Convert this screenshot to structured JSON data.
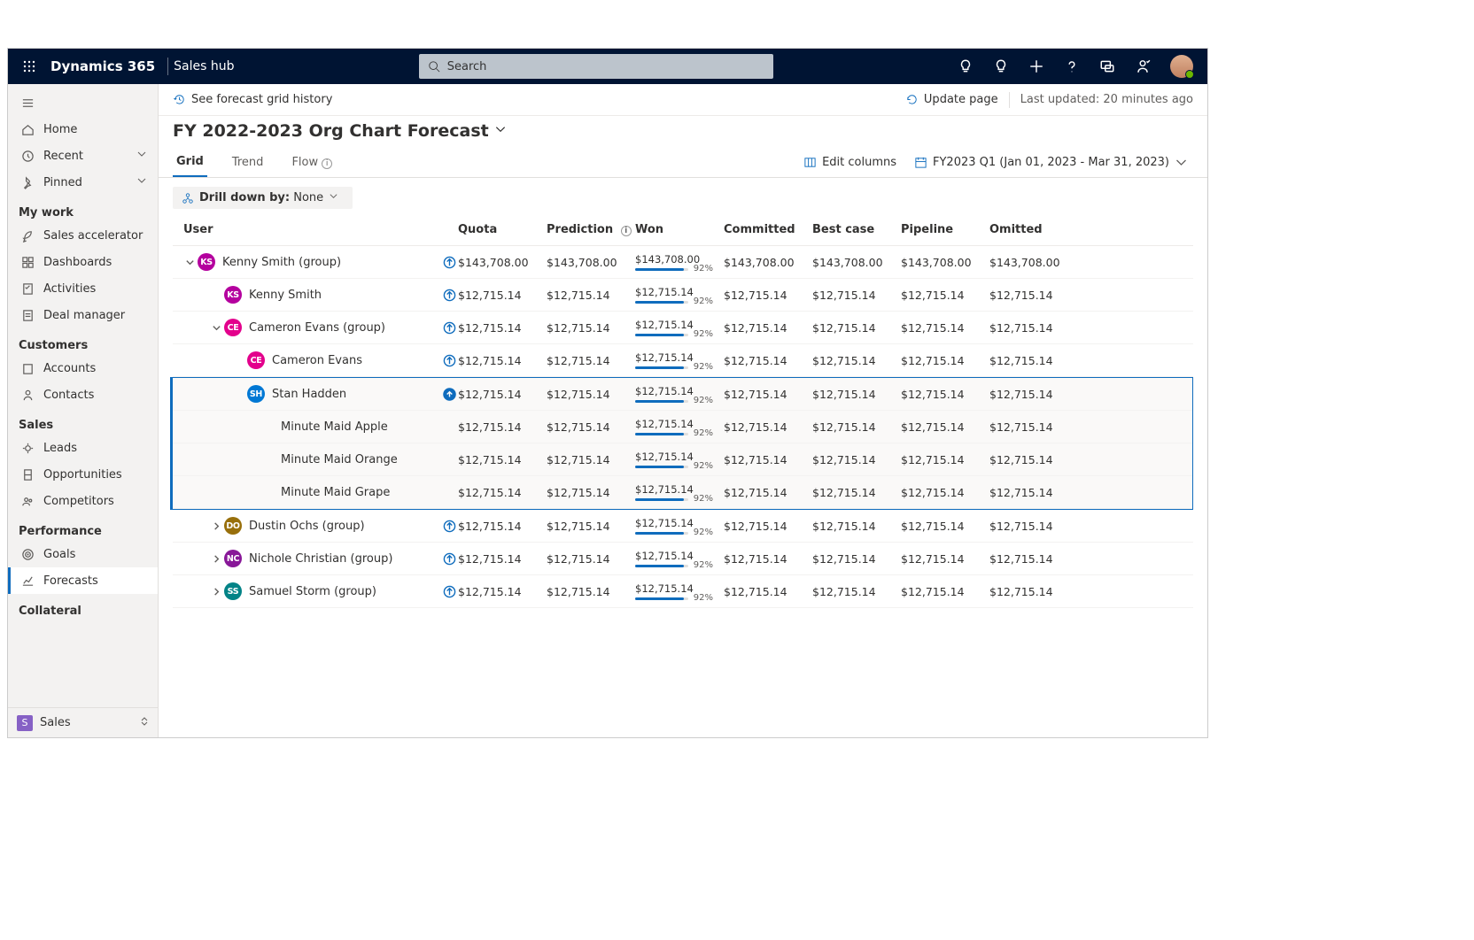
{
  "topbar": {
    "brand": "Dynamics 365",
    "hub": "Sales hub",
    "search_placeholder": "Search"
  },
  "sidebar": {
    "nav": [
      {
        "label": "Home"
      },
      {
        "label": "Recent",
        "chev": true
      },
      {
        "label": "Pinned",
        "chev": true
      }
    ],
    "groups": [
      {
        "title": "My work",
        "items": [
          "Sales accelerator",
          "Dashboards",
          "Activities",
          "Deal manager"
        ]
      },
      {
        "title": "Customers",
        "items": [
          "Accounts",
          "Contacts"
        ]
      },
      {
        "title": "Sales",
        "items": [
          "Leads",
          "Opportunities",
          "Competitors"
        ]
      },
      {
        "title": "Performance",
        "items": [
          "Goals",
          "Forecasts"
        ]
      },
      {
        "title": "Collateral",
        "items": []
      }
    ],
    "area": "Sales",
    "active": "Forecasts"
  },
  "cmdbar": {
    "history": "See forecast grid history",
    "update": "Update page",
    "last": "Last updated: 20 minutes ago"
  },
  "title": "FY 2022-2023 Org Chart Forecast",
  "tabs": {
    "items": [
      "Grid",
      "Trend",
      "Flow"
    ],
    "active": "Grid",
    "edit": "Edit columns",
    "period": "FY2023 Q1 (Jan 01, 2023 - Mar 31, 2023)"
  },
  "drill": {
    "label": "Drill down by:",
    "value": "None"
  },
  "columns": [
    "User",
    "Quota",
    "Prediction",
    "Won",
    "Committed",
    "Best case",
    "Pipeline",
    "Omitted"
  ],
  "rows": [
    {
      "indent": 0,
      "exp": "down",
      "avatar": "KS",
      "color": "#b4009e",
      "name": "Kenny Smith (group)",
      "freeze": "ring",
      "quota": "$143,708.00",
      "pred": "$143,708.00",
      "won": "$143,708.00",
      "pct": 92,
      "committed": "$143,708.00",
      "best": "$143,708.00",
      "pipe": "$143,708.00",
      "omit": "$143,708.00"
    },
    {
      "indent": 1,
      "avatar": "KS",
      "color": "#b4009e",
      "name": "Kenny Smith",
      "freeze": "ring",
      "quota": "$12,715.14",
      "pred": "$12,715.14",
      "won": "$12,715.14",
      "pct": 92,
      "committed": "$12,715.14",
      "best": "$12,715.14",
      "pipe": "$12,715.14",
      "omit": "$12,715.14"
    },
    {
      "indent": 1,
      "exp": "down",
      "avatar": "CE",
      "color": "#e3008c",
      "name": "Cameron Evans (group)",
      "freeze": "ring",
      "quota": "$12,715.14",
      "pred": "$12,715.14",
      "won": "$12,715.14",
      "pct": 92,
      "committed": "$12,715.14",
      "best": "$12,715.14",
      "pipe": "$12,715.14",
      "omit": "$12,715.14"
    },
    {
      "indent": 2,
      "avatar": "CE",
      "color": "#e3008c",
      "name": "Cameron Evans",
      "freeze": "ring",
      "quota": "$12,715.14",
      "pred": "$12,715.14",
      "won": "$12,715.14",
      "pct": 92,
      "committed": "$12,715.14",
      "best": "$12,715.14",
      "pipe": "$12,715.14",
      "omit": "$12,715.14"
    },
    {
      "indent": 2,
      "avatar": "SH",
      "color": "#0078d4",
      "name": "Stan Hadden",
      "freeze": "up",
      "quota": "$12,715.14",
      "pred": "$12,715.14",
      "won": "$12,715.14",
      "pct": 92,
      "committed": "$12,715.14",
      "best": "$12,715.14",
      "pipe": "$12,715.14",
      "omit": "$12,715.14",
      "sel": true
    },
    {
      "indent": 3,
      "name": "Minute Maid Apple",
      "quota": "$12,715.14",
      "pred": "$12,715.14",
      "won": "$12,715.14",
      "pct": 92,
      "committed": "$12,715.14",
      "best": "$12,715.14",
      "pipe": "$12,715.14",
      "omit": "$12,715.14",
      "sel": true
    },
    {
      "indent": 3,
      "name": "Minute Maid Orange",
      "quota": "$12,715.14",
      "pred": "$12,715.14",
      "won": "$12,715.14",
      "pct": 92,
      "committed": "$12,715.14",
      "best": "$12,715.14",
      "pipe": "$12,715.14",
      "omit": "$12,715.14",
      "sel": true
    },
    {
      "indent": 3,
      "name": "Minute Maid Grape",
      "quota": "$12,715.14",
      "pred": "$12,715.14",
      "won": "$12,715.14",
      "pct": 92,
      "committed": "$12,715.14",
      "best": "$12,715.14",
      "pipe": "$12,715.14",
      "omit": "$12,715.14",
      "sel": true
    },
    {
      "indent": 1,
      "exp": "right",
      "avatar": "DO",
      "color": "#986f0b",
      "name": "Dustin Ochs (group)",
      "freeze": "ring",
      "quota": "$12,715.14",
      "pred": "$12,715.14",
      "won": "$12,715.14",
      "pct": 92,
      "committed": "$12,715.14",
      "best": "$12,715.14",
      "pipe": "$12,715.14",
      "omit": "$12,715.14"
    },
    {
      "indent": 1,
      "exp": "right",
      "avatar": "NC",
      "color": "#881798",
      "name": "Nichole Christian (group)",
      "freeze": "ring",
      "quota": "$12,715.14",
      "pred": "$12,715.14",
      "won": "$12,715.14",
      "pct": 92,
      "committed": "$12,715.14",
      "best": "$12,715.14",
      "pipe": "$12,715.14",
      "omit": "$12,715.14"
    },
    {
      "indent": 1,
      "exp": "right",
      "avatar": "SS",
      "color": "#038387",
      "name": "Samuel Storm (group)",
      "freeze": "ring",
      "quota": "$12,715.14",
      "pred": "$12,715.14",
      "won": "$12,715.14",
      "pct": 92,
      "committed": "$12,715.14",
      "best": "$12,715.14",
      "pipe": "$12,715.14",
      "omit": "$12,715.14"
    }
  ]
}
